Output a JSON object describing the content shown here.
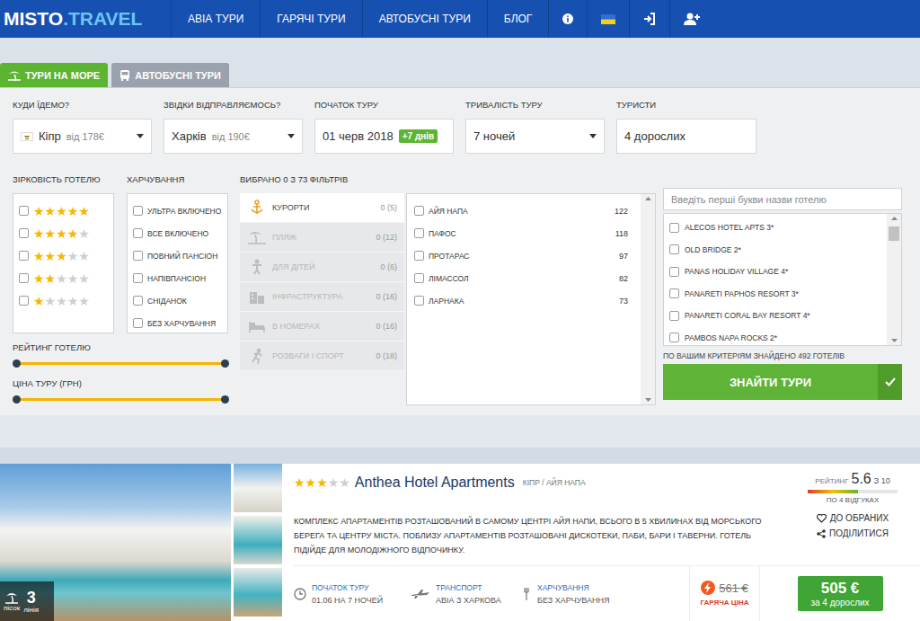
{
  "nav": {
    "logo": {
      "main": "MISTO",
      "accent": ".TRAVEL"
    },
    "items": [
      {
        "label": "АВІА ТУРИ"
      },
      {
        "label": "ГАРЯЧІ ТУРИ"
      },
      {
        "label": "АВТОБУСНІ ТУРИ"
      },
      {
        "label": "БЛОГ"
      }
    ]
  },
  "tabs": [
    {
      "label": "ТУРИ НА МОРЕ",
      "selected": true,
      "kind": "sea"
    },
    {
      "label": "АВТОБУСНІ ТУРИ",
      "selected": false,
      "kind": "bus"
    }
  ],
  "search": {
    "fields": [
      {
        "label": "КУДИ ЇДЕМО?",
        "value": "Кіпр",
        "hint": "від 178€",
        "kind": "country"
      },
      {
        "label": "ЗВІДКИ ВІДПРАВЛЯЄМОСЬ?",
        "value": "Харків",
        "hint": "від 190€",
        "kind": "select"
      },
      {
        "label": "ПОЧАТОК ТУРУ",
        "value": "01 черв 2018",
        "badge": "+7 днів",
        "kind": "date"
      },
      {
        "label": "ТРИВАЛІСТЬ ТУРУ",
        "value": "7 ночей",
        "kind": "select"
      },
      {
        "label": "ТУРИСТИ",
        "value": "4 дорослих",
        "kind": "text"
      }
    ]
  },
  "stars_filter": {
    "label": "ЗІРКОВІСТЬ ГОТЕЛЮ",
    "options": [
      {
        "stars": 5,
        "checked": false
      },
      {
        "stars": 4,
        "checked": false
      },
      {
        "stars": 3,
        "checked": false
      },
      {
        "stars": 2,
        "checked": false
      },
      {
        "stars": 1,
        "checked": false
      }
    ]
  },
  "meals": {
    "label": "ХАРЧУВАННЯ",
    "options": [
      {
        "label": "УЛЬТРА ВКЛЮЧЕНО",
        "checked": false
      },
      {
        "label": "ВСЕ ВКЛЮЧЕНО",
        "checked": false
      },
      {
        "label": "ПОВНИЙ ПАНСІОН",
        "checked": false
      },
      {
        "label": "НАПІВПАНСІОН",
        "checked": false
      },
      {
        "label": "СНІДАНОК",
        "checked": false
      },
      {
        "label": "БЕЗ ХАРЧУВАННЯ",
        "checked": false
      }
    ]
  },
  "sliders": [
    {
      "label": "РЕЙТИНГ ГОТЕЛЮ",
      "from": 0,
      "level": 1
    },
    {
      "label": "ЦІНА ТУРУ (ГРН)",
      "from": 0,
      "level": 1
    }
  ],
  "filters": {
    "summary": "ВИБРАНО 0 З 73 ФІЛЬТРІВ",
    "categories": [
      {
        "label": "КУРОРТИ",
        "count": "0 (5)",
        "selected": true,
        "kind": "resort"
      },
      {
        "label": "ПЛЯЖ",
        "count": "0 (12)",
        "selected": false,
        "kind": "beach"
      },
      {
        "label": "ДЛЯ ДІТЕЙ",
        "count": "0 (6)",
        "selected": false,
        "kind": "kids"
      },
      {
        "label": "ІНФРАСТРУКТУРА",
        "count": "0 (16)",
        "selected": false,
        "kind": "infra"
      },
      {
        "label": "В НОМЕРАХ",
        "count": "0 (16)",
        "selected": false,
        "kind": "room"
      },
      {
        "label": "РОЗВАГИ І СПОРТ",
        "count": "0 (18)",
        "selected": false,
        "kind": "sport"
      }
    ],
    "options": [
      {
        "label": "АЙЯ НАПА",
        "count": "122",
        "checked": false
      },
      {
        "label": "ПАФОС",
        "count": "118",
        "checked": false
      },
      {
        "label": "ПРОТАРАС",
        "count": "97",
        "checked": false
      },
      {
        "label": "ЛІМАССОЛ",
        "count": "82",
        "checked": false
      },
      {
        "label": "ЛАРНАКА",
        "count": "73",
        "checked": false
      }
    ]
  },
  "hotels": {
    "placeholder": "Введіть перші букви назви готелю",
    "scroll": 0,
    "items": [
      {
        "label": "ALECOS HOTEL APTS 3*",
        "checked": false
      },
      {
        "label": "OLD BRIDGE 2*",
        "checked": false
      },
      {
        "label": "PANAS HOLIDAY VILLAGE 4*",
        "checked": false
      },
      {
        "label": "PANARETI PAPHOS RESORT 3*",
        "checked": false
      },
      {
        "label": "PANARETI CORAL BAY RESORT 4*",
        "checked": false
      },
      {
        "label": "PAMBOS NAPA ROCKS 2*",
        "checked": false
      }
    ],
    "found": "ПО ВАШИМ КРИТЕРІЯМ ЗНАЙДЕНО 492 ГОТЕЛІВ",
    "button": "ЗНАЙТИ ТУРИ"
  },
  "result": {
    "stars": 3,
    "name": "Anthea Hotel Apartments",
    "location": "КІПР / АЙЯ НАПА",
    "description": "КОМПЛЕКС АПАРТАМЕНТІВ РОЗТАШОВАНИЙ В САМОМУ ЦЕНТРІ АЙЯ НАПИ, ВСЬОГО В 5 ХВИЛИНАХ ВІД МОРСЬКОГО БЕРЕГА ТА ЦЕНТРУ МІСТА. ПОБЛИЗУ АПАРТАМЕНТІВ РОЗТАШОВАНІ ДИСКОТЕКИ, ПАБИ, БАРИ І ТАВЕРНИ. ГОТЕЛЬ ПІДІЙДЕ ДЛЯ МОЛОДІЖНОГО ВІДПОЧИНКУ.",
    "beach": "пісок",
    "line_number": "3",
    "line_label": "лінія",
    "details": [
      {
        "label": "ПОЧАТОК ТУРУ",
        "value": "01.06 НА 7 НОЧЕЙ",
        "kind": "date"
      },
      {
        "label": "ТРАНСПОРТ",
        "value": "АВІА З ХАРКОВА",
        "kind": "transport"
      },
      {
        "label": "ХАРЧУВАННЯ",
        "value": "БЕЗ ХАРЧУВАННЯ",
        "kind": "meal"
      }
    ],
    "old_price": "561 €",
    "hot_label": "ГАРЯЧА ЦІНА",
    "price": "505 €",
    "price_note": "за 4 дорослих",
    "rating": {
      "label": "РЕЙТИНГ",
      "value": "5.6",
      "scale": "З 10",
      "level": 0.56,
      "reviews": "ПО 4 ВІДГУКАХ"
    },
    "favorite": "ДО ОБРАНИХ",
    "share": "ПОДІЛИТИСЯ"
  }
}
